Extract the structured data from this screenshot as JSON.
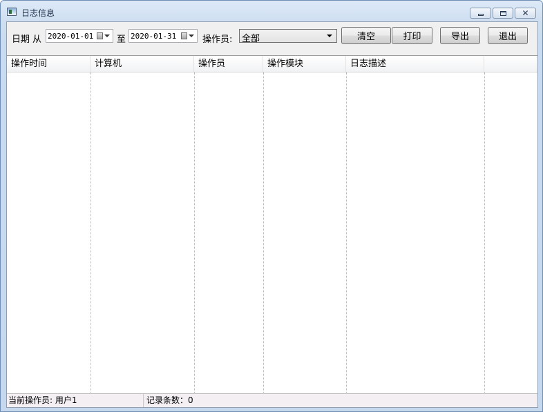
{
  "window": {
    "title": "日志信息",
    "app_icon": "window-app-icon",
    "controls": {
      "minimize": "minimize-icon",
      "maximize": "maximize-icon",
      "close": "close-icon"
    }
  },
  "toolbar": {
    "date_label": "日期",
    "from_label": "从",
    "from_date": "2020-01-01",
    "to_label": "至",
    "to_date": "2020-01-31",
    "operator_label": "操作员:",
    "operator_value": "全部",
    "clear_label": "清空",
    "print_label": "打印",
    "export_label": "导出",
    "exit_label": "退出"
  },
  "table": {
    "columns": [
      "操作时间",
      "计算机",
      "操作员",
      "操作模块",
      "日志描述"
    ],
    "rows": []
  },
  "status": {
    "current_operator": "当前操作员: 用户1",
    "record_count": "记录条数：0"
  }
}
